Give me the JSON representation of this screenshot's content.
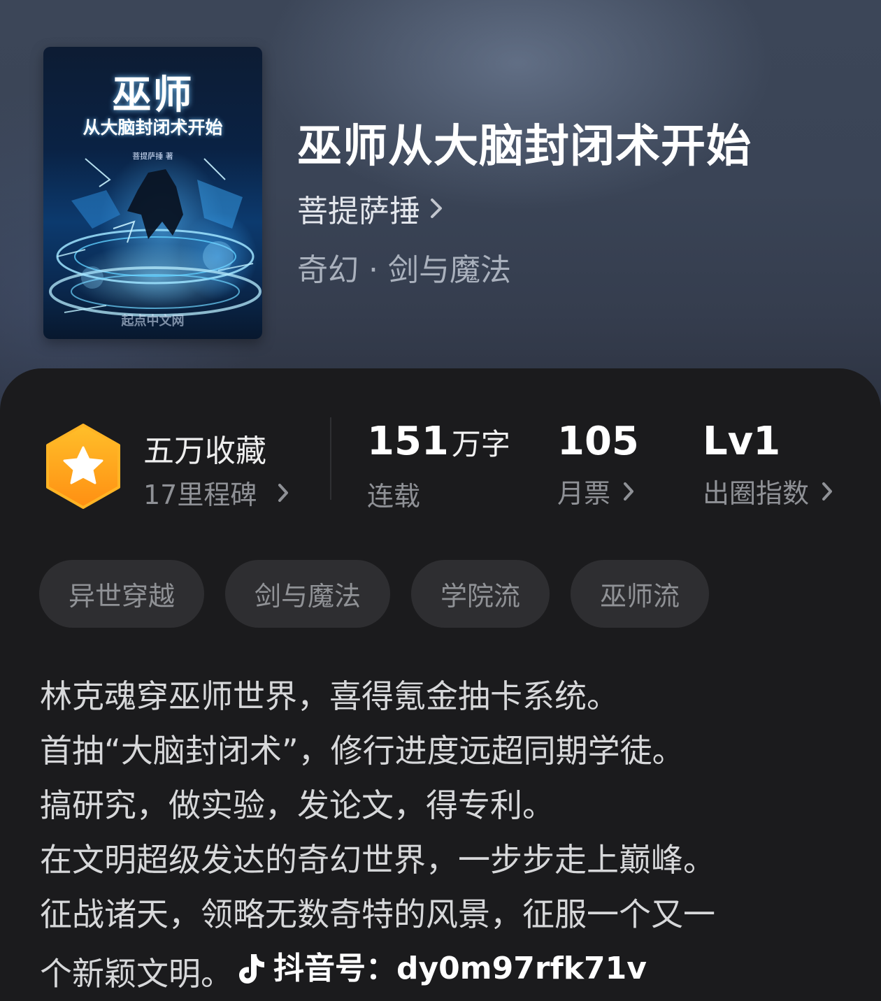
{
  "cover": {
    "title": "巫师",
    "subtitle": "从大脑封闭术开始",
    "author": "菩提萨捶 著",
    "publisher": "起点中文网"
  },
  "book": {
    "title": "巫师从大脑封闭术开始",
    "author": "菩提萨捶",
    "genre": "奇幻 · 剑与魔法"
  },
  "stats": {
    "collection": {
      "title": "五万收藏",
      "milestone": "17里程碑",
      "icon": "star-hexagon-icon",
      "badge_color": "#ffa51f"
    },
    "words": {
      "value": "151",
      "unit": "万字",
      "label": "连载"
    },
    "monthly_ticket": {
      "value": "105",
      "label": "月票"
    },
    "breakout": {
      "value": "Lv1",
      "label": "出圈指数"
    }
  },
  "tags": [
    "异世穿越",
    "剑与魔法",
    "学院流",
    "巫师流"
  ],
  "description": {
    "lines": [
      "林克魂穿巫师世界，喜得氪金抽卡系统。",
      "首抽“大脑封闭术”，修行进度远超同期学徒。",
      "搞研究，做实验，发论文，得专利。",
      "在文明超级发达的奇幻世界，一步步走上巅峰。",
      "征战诸天，领略无数奇特的风景，征服一个又一"
    ],
    "last_line": "个新颖文明。"
  },
  "watermark": {
    "icon": "tiktok-icon",
    "text": "抖音号：dy0m97rfk71v"
  }
}
